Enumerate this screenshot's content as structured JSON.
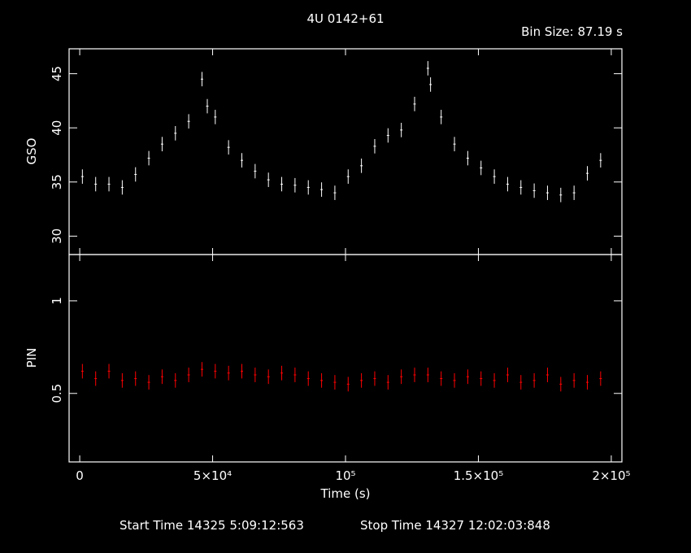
{
  "header": {
    "title": "4U 0142+61",
    "bin_size": "Bin Size: 87.19 s"
  },
  "footer": {
    "start": "Start Time 14325  5:09:12:563",
    "stop": "Stop Time 14327 12:02:03:848"
  },
  "chart_data": [
    {
      "type": "scatter",
      "panel": "top",
      "ylabel": "GSO",
      "xlabel": "",
      "xlim": [
        -4000,
        204000
      ],
      "ylim": [
        28.3,
        47.3
      ],
      "yticks": [
        30,
        35,
        40,
        45
      ],
      "ytick_labels": [
        "30",
        "35",
        "40",
        "45"
      ],
      "color": "#ffffff",
      "errorbars": true,
      "x": [
        1000,
        6000,
        11000,
        16000,
        21000,
        26000,
        31000,
        36000,
        41000,
        46000,
        48000,
        51000,
        56000,
        61000,
        66000,
        71000,
        76000,
        81000,
        86000,
        91000,
        96000,
        101000,
        106000,
        111000,
        116000,
        121000,
        126000,
        131000,
        132000,
        136000,
        141000,
        146000,
        151000,
        156000,
        161000,
        166000,
        171000,
        176000,
        181000,
        186000,
        191000,
        196000
      ],
      "y": [
        35.5,
        34.8,
        34.8,
        34.5,
        35.7,
        37.2,
        38.5,
        39.5,
        40.6,
        44.5,
        42.0,
        41.0,
        38.2,
        37.0,
        36.0,
        35.2,
        34.8,
        34.7,
        34.5,
        34.3,
        34.0,
        35.5,
        36.5,
        38.3,
        39.3,
        39.8,
        42.2,
        45.5,
        44.0,
        41.0,
        38.5,
        37.2,
        36.3,
        35.5,
        34.8,
        34.5,
        34.2,
        34.0,
        33.8,
        34.0,
        35.8,
        37.0
      ]
    },
    {
      "type": "scatter",
      "panel": "bottom",
      "ylabel": "PIN",
      "xlabel": "Time (s)",
      "xlim": [
        -4000,
        204000
      ],
      "ylim": [
        0.13,
        1.25
      ],
      "yticks": [
        0.5,
        1
      ],
      "ytick_labels": [
        "0.5",
        "1"
      ],
      "xticks": [
        0,
        50000,
        100000,
        150000,
        200000
      ],
      "xtick_labels": [
        "0",
        "5×10⁴",
        "10⁵",
        "1.5×10⁵",
        "2×10⁵"
      ],
      "color": "#ff0000",
      "errorbars": true,
      "x": [
        1000,
        6000,
        11000,
        16000,
        21000,
        26000,
        31000,
        36000,
        41000,
        46000,
        51000,
        56000,
        61000,
        66000,
        71000,
        76000,
        81000,
        86000,
        91000,
        96000,
        101000,
        106000,
        111000,
        116000,
        121000,
        126000,
        131000,
        136000,
        141000,
        146000,
        151000,
        156000,
        161000,
        166000,
        171000,
        176000,
        181000,
        186000,
        191000,
        196000
      ],
      "y": [
        0.62,
        0.58,
        0.62,
        0.57,
        0.58,
        0.56,
        0.59,
        0.57,
        0.6,
        0.63,
        0.62,
        0.61,
        0.62,
        0.6,
        0.59,
        0.61,
        0.6,
        0.58,
        0.57,
        0.56,
        0.55,
        0.57,
        0.58,
        0.56,
        0.59,
        0.6,
        0.6,
        0.58,
        0.57,
        0.59,
        0.58,
        0.57,
        0.6,
        0.56,
        0.57,
        0.6,
        0.55,
        0.57,
        0.56,
        0.58
      ]
    }
  ]
}
